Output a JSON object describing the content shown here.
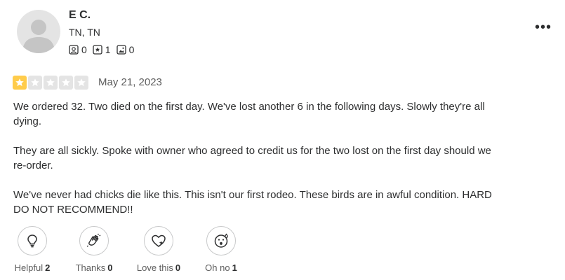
{
  "user": {
    "name": "E C.",
    "location": "TN, TN",
    "stats": {
      "friends": "0",
      "reviews": "1",
      "photos": "0"
    }
  },
  "menu_icon": "more-horizontal-icon",
  "review": {
    "rating": 1,
    "rating_max": 5,
    "date": "May 21, 2023",
    "paragraphs": [
      "We ordered 32. Two died on the first day. We've lost another 6 in the following days. Slowly they're all dying.",
      "They are all sickly. Spoke with owner who agreed to credit us for the two lost on the first day should we re-order.",
      "We've never had chicks die like this. This isn't our first rodeo. These birds are in awful condition. HARD DO NOT RECOMMEND!!"
    ]
  },
  "reactions": [
    {
      "label": "Helpful",
      "count": "2",
      "icon": "lightbulb-icon"
    },
    {
      "label": "Thanks",
      "count": "0",
      "icon": "clapping-hands-icon"
    },
    {
      "label": "Love this",
      "count": "0",
      "icon": "heart-icon"
    },
    {
      "label": "Oh no",
      "count": "1",
      "icon": "surprised-face-icon"
    }
  ],
  "colors": {
    "star_filled": "#ffcc4b",
    "star_empty": "#e4e4e4",
    "text": "#2d2e2f",
    "muted": "#5d5d5d"
  }
}
